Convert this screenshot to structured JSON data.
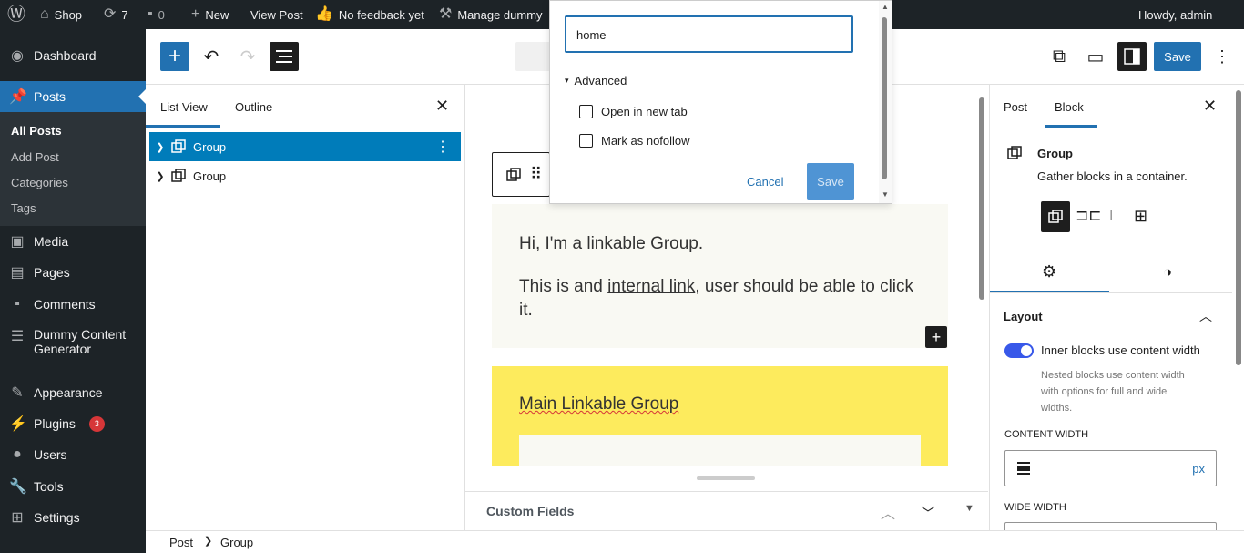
{
  "adminbar": {
    "site_name": "Shop",
    "updates_count": "7",
    "comments_count": "0",
    "new_label": "New",
    "view_post_label": "View Post",
    "feedback_label": "No feedback yet",
    "manage_label": "Manage dummy",
    "howdy_label": "Howdy, admin"
  },
  "sidebar": {
    "dashboard": "Dashboard",
    "posts": "Posts",
    "all_posts": "All Posts",
    "add_post": "Add Post",
    "categories": "Categories",
    "tags": "Tags",
    "media": "Media",
    "pages": "Pages",
    "comments": "Comments",
    "dummy_line1": "Dummy Content",
    "dummy_line2": "Generator",
    "appearance": "Appearance",
    "plugins": "Plugins",
    "plugins_badge": "3",
    "users": "Users",
    "tools": "Tools",
    "settings": "Settings"
  },
  "toolbar": {
    "save_label": "Save"
  },
  "listview": {
    "tab_list_view": "List View",
    "tab_outline": "Outline",
    "rows": [
      {
        "label": "Group"
      },
      {
        "label": "Group"
      }
    ]
  },
  "canvas": {
    "block1_line1": "Hi, I'm a linkable Group.",
    "block1_line2_prefix": "This is and ",
    "block1_link": "internal link",
    "block1_line2_suffix": ", user should be able to click",
    "block1_line3": "it.",
    "block2_title": "Main Linkable Group",
    "custom_fields": "Custom Fields"
  },
  "popover": {
    "input_value": "home",
    "advanced_label": "Advanced",
    "open_new_tab": "Open in new tab",
    "nofollow": "Mark as nofollow",
    "cancel_label": "Cancel",
    "save_label": "Save"
  },
  "settings": {
    "tab_post": "Post",
    "tab_block": "Block",
    "block_name": "Group",
    "block_desc": "Gather blocks in a container.",
    "layout_title": "Layout",
    "toggle_label": "Inner blocks use content width",
    "help_line1": "Nested blocks use content width",
    "help_line2": "with options for full and wide",
    "help_line3": "widths.",
    "content_width_label": "CONTENT WIDTH",
    "unit_px": "px",
    "wide_width_label": "WIDE WIDTH"
  },
  "footer": {
    "crumb_post": "Post",
    "crumb_group": "Group"
  },
  "colors": {
    "admin_dark": "#1d2327",
    "accent_blue": "#2271b1",
    "wp_blue": "#3858e9",
    "selected_row": "#007cba",
    "yellow_block": "#fdeb5d",
    "cream_block": "#f9f9f3"
  }
}
